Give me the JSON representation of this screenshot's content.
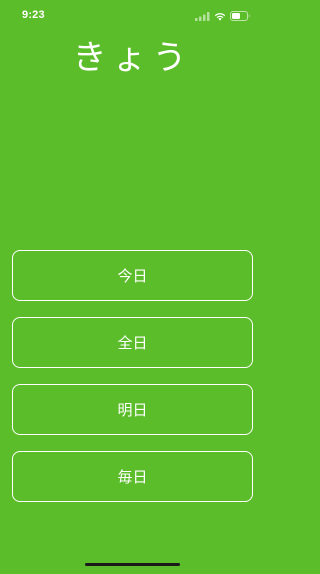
{
  "status_bar": {
    "time": "9:23",
    "icons": [
      "cellular-signal-icon",
      "wifi-icon",
      "battery-icon"
    ]
  },
  "quiz": {
    "word": "きょう",
    "choices": [
      "今日",
      "全日",
      "明日",
      "毎日"
    ]
  },
  "colors": {
    "background": "#5cbd2b",
    "text": "#ffffff",
    "home_indicator": "#1a1a1a"
  }
}
